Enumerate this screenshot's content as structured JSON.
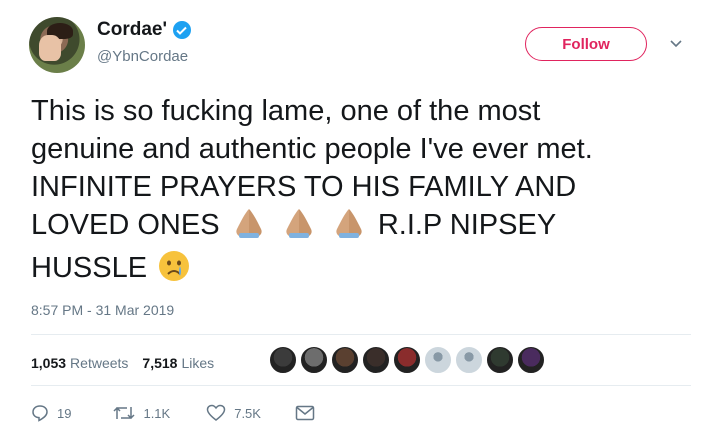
{
  "user": {
    "display_name": "Cordae'",
    "handle": "@YbnCordae",
    "verified_icon": "verified-badge-icon"
  },
  "follow_button": {
    "label": "Follow"
  },
  "tweet": {
    "lines": [
      "This is so fucking lame, one of the most",
      "genuine and authentic people I've ever met.",
      "INFINITE PRAYERS TO HIS FAMILY AND",
      "LOVED ONES",
      "R.I.P NIPSEY",
      "HUSSLE"
    ],
    "emojis": [
      "folded-hands-emoji",
      "folded-hands-emoji",
      "folded-hands-emoji",
      "crying-face-emoji"
    ],
    "timestamp": "8:57 PM - 31 Mar 2019"
  },
  "stats": {
    "retweets_count": "1,053",
    "retweets_label": "Retweets",
    "likes_count": "7,518",
    "likes_label": "Likes"
  },
  "likers": [
    {
      "color": "#3b3b3b"
    },
    {
      "color": "#6d6d6d"
    },
    {
      "color": "#5a4030"
    },
    {
      "color": "#3a2e2a"
    },
    {
      "color": "#8a2c2c"
    },
    {
      "color": "#a9b4bf"
    },
    {
      "color": "#a9b4bf"
    },
    {
      "color": "#2f3a30"
    },
    {
      "color": "#4a2b5e"
    }
  ],
  "actions": {
    "reply_count": "19",
    "retweet_count": "1.1K",
    "like_count": "7.5K"
  },
  "colors": {
    "accent": "#1da1f2",
    "follow": "#e0245e",
    "secondary_text": "#657786"
  }
}
